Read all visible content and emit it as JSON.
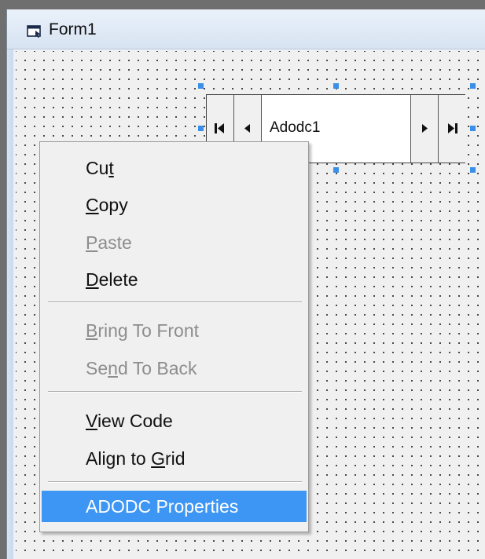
{
  "window": {
    "title": "Form1",
    "icon": "form-icon"
  },
  "adodc": {
    "caption": "Adodc1",
    "buttons": [
      "move-first-icon",
      "move-previous-icon",
      "move-next-icon",
      "move-last-icon"
    ]
  },
  "context_menu": {
    "items": [
      {
        "before": "Cu",
        "key": "t",
        "after": "",
        "enabled": true,
        "selected": false
      },
      {
        "before": "",
        "key": "C",
        "after": "opy",
        "enabled": true,
        "selected": false
      },
      {
        "before": "",
        "key": "P",
        "after": "aste",
        "enabled": false,
        "selected": false
      },
      {
        "before": "",
        "key": "D",
        "after": "elete",
        "enabled": true,
        "selected": false
      },
      {
        "before": "",
        "key": "B",
        "after": "ring To Front",
        "enabled": false,
        "selected": false
      },
      {
        "before": "Se",
        "key": "n",
        "after": "d To Back",
        "enabled": false,
        "selected": false
      },
      {
        "before": "",
        "key": "V",
        "after": "iew Code",
        "enabled": true,
        "selected": false
      },
      {
        "before": "Align to ",
        "key": "G",
        "after": "rid",
        "enabled": true,
        "selected": false
      },
      {
        "before": "ADODC Properties",
        "key": "",
        "after": "",
        "enabled": true,
        "selected": true
      }
    ]
  },
  "colors": {
    "selection": "#3d96f4",
    "selection_handles": "#3a8fe8",
    "disabled_text": "#8d8d8d"
  }
}
